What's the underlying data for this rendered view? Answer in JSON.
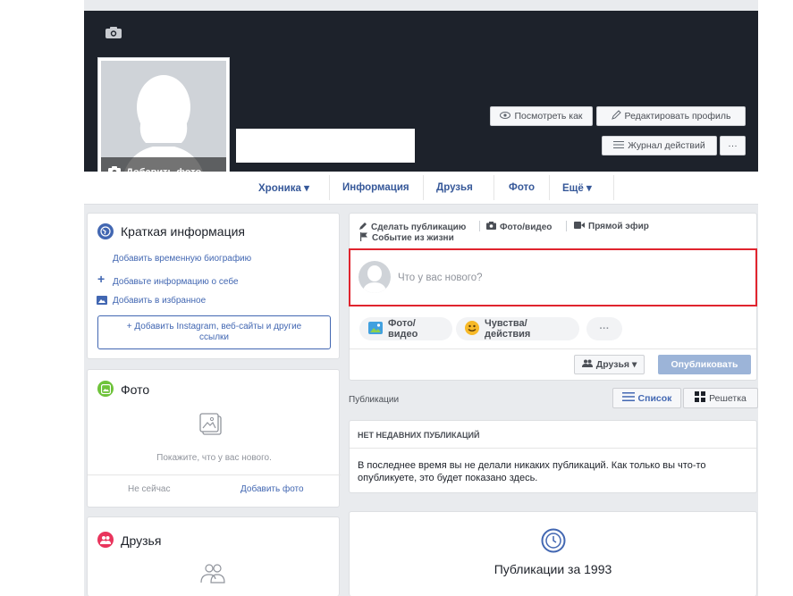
{
  "profile": {
    "add_photo_label": "Добавить фото"
  },
  "cover_actions": {
    "view_as": "Посмотреть как",
    "edit_profile": "Редактировать профиль",
    "activity_log": "Журнал действий",
    "more": "···"
  },
  "nav": {
    "tabs": [
      {
        "label": "Хроника ▾"
      },
      {
        "label": "Информация"
      },
      {
        "label": "Друзья"
      },
      {
        "label": "Фото"
      },
      {
        "label": "Ещё ▾"
      }
    ]
  },
  "intro": {
    "title": "Краткая информация",
    "add_bio": "Добавить временную биографию",
    "add_info": "Добавьте информацию о себе",
    "add_featured": "Добавить в избранное",
    "add_instagram_line1": "+ Добавить Instagram, веб-сайты и другие",
    "add_instagram_line2": "ссылки"
  },
  "photos": {
    "title": "Фото",
    "prompt": "Покажите, что у вас нового.",
    "not_now": "Не сейчас",
    "add_photo": "Добавить фото"
  },
  "friends": {
    "title": "Друзья"
  },
  "composer": {
    "make_post": "Сделать публикацию",
    "photo_video": "Фото/видео",
    "live": "Прямой эфир",
    "life_event": "Событие из жизни",
    "placeholder": "Что у вас нового?",
    "pill_photo": "Фото/видео",
    "pill_feelings": "Чувства/действия",
    "pill_more": "···",
    "audience": "Друзья ▾",
    "publish": "Опубликовать",
    "highlight_color": "#e0242e"
  },
  "posts": {
    "header": "Публикации",
    "list_view": "Список",
    "grid_view": "Решетка",
    "no_recent_title": "НЕТ НЕДАВНИХ ПУБЛИКАЦИЙ",
    "no_recent_text": "В последнее время вы не делали никаких публикаций. Как только вы что-то опубликуете, это будет показано здесь.",
    "year_label": "Публикации за 1993"
  },
  "colors": {
    "cover_bg": "#1d222b",
    "link_blue": "#4267b2",
    "nav_blue": "#365899",
    "publish_btn": "#9cb4d8",
    "page_bg": "#e9ebee"
  }
}
